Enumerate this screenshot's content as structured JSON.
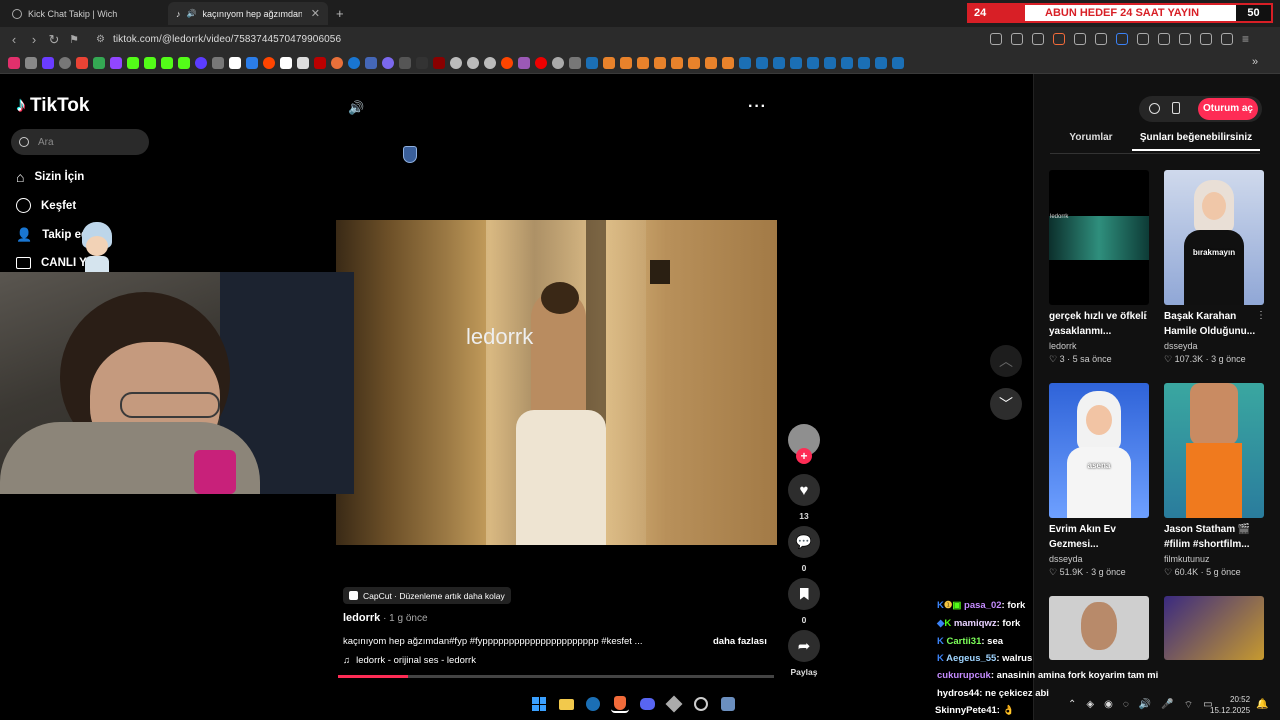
{
  "tabs": [
    {
      "title": "Kick Chat Takip | Wich",
      "active": false
    },
    {
      "title": "kaçınıyom hep ağzımdan#fyp",
      "active": true
    }
  ],
  "overlay": {
    "left_number": "24",
    "text": "ABUN HEDEF 24 SAAT YAYIN",
    "right_number": "50"
  },
  "toolbar": {
    "url": "tiktok.com/@ledorrk/video/7583744570479906056"
  },
  "tiktok": {
    "logo": "TikTok",
    "search_placeholder": "Ara",
    "nav": [
      "Sizin İçin",
      "Keşfet",
      "Takip ed",
      "CANLI Y"
    ],
    "login_button": "Oturum aç",
    "tabs": [
      "Yorumlar",
      "Şunları beğenebilirsiniz"
    ]
  },
  "video": {
    "watermark": "ledorrk",
    "likes": "13",
    "comments": "0",
    "saves": "0",
    "share_label": "Paylaş",
    "capcut": "CapCut · Düzenleme artık daha kolay",
    "author": "ledorrk",
    "time": " · 1 g önce",
    "description": "kaçınıyom hep ağzımdan#fyp #fypppppppppppppppppppppp #kesfet ...",
    "more": "daha fazlası",
    "sound": "ledorrk - orijinal ses - ledorrk",
    "progress": 0.16
  },
  "recommendations": [
    {
      "title": "gerçek hızlı ve öfkeli yasaklanmı...",
      "author": "ledorrk",
      "likes": "3",
      "age": "5 sa önce",
      "thumb_text": "ledorrk"
    },
    {
      "title": "Başak Karahan Hamile Olduğunu...",
      "author": "dsseyda",
      "likes": "107.3K",
      "age": "3 g önce",
      "thumb_text": "bırakmayın"
    },
    {
      "title": "Evrim Akın Ev Gezmesi...",
      "author": "dsseyda",
      "likes": "51.9K",
      "age": "3 g önce",
      "thumb_text": "asena"
    },
    {
      "title": "Jason Statham 🎬 #filim #shortfilm...",
      "author": "filmkutunuz",
      "likes": "60.4K",
      "age": "5 g önce",
      "thumb_text": ""
    }
  ],
  "chat": [
    {
      "user": "pasa_02",
      "msg": ": fork",
      "color": "#c58cff"
    },
    {
      "user": "mamiqwz",
      "msg": ": fork",
      "color": "#e8d2ff"
    },
    {
      "user": "Cartii31",
      "msg": ": sea",
      "color": "#7dff5a"
    },
    {
      "user": "Aegeus_55",
      "msg": ": walrus",
      "color": "#9fd4ff"
    },
    {
      "user": "cukurupcuk",
      "msg": ": anasinin amina fork koyarim tam mi",
      "color": "#c58cff"
    },
    {
      "user": "hydros44",
      "msg": ": ne çekicez abi",
      "color": "#ffffff"
    },
    {
      "user": "SkinnyPete41",
      "msg": ": 👌",
      "color": "#ffffff"
    }
  ],
  "clock": {
    "time": "20:52",
    "date": "15.12.2025"
  }
}
